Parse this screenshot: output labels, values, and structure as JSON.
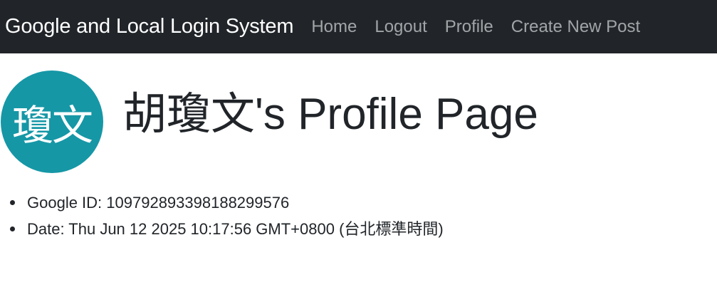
{
  "navbar": {
    "brand": "Google and Local Login System",
    "links": [
      {
        "label": "Home"
      },
      {
        "label": "Logout"
      },
      {
        "label": "Profile"
      },
      {
        "label": "Create New Post"
      }
    ]
  },
  "profile": {
    "avatar_text": "瓊文",
    "avatar_color": "#1597a6",
    "title": "胡瓊文's Profile Page",
    "details": [
      {
        "text": "Google ID: 109792893398188299576"
      },
      {
        "text": "Date: Thu Jun 12 2025 10:17:56 GMT+0800 (台北標準時間)"
      }
    ]
  },
  "colors": {
    "navbar_bg": "#212529",
    "nav_link": "#a2a5a8",
    "brand": "#ffffff"
  }
}
